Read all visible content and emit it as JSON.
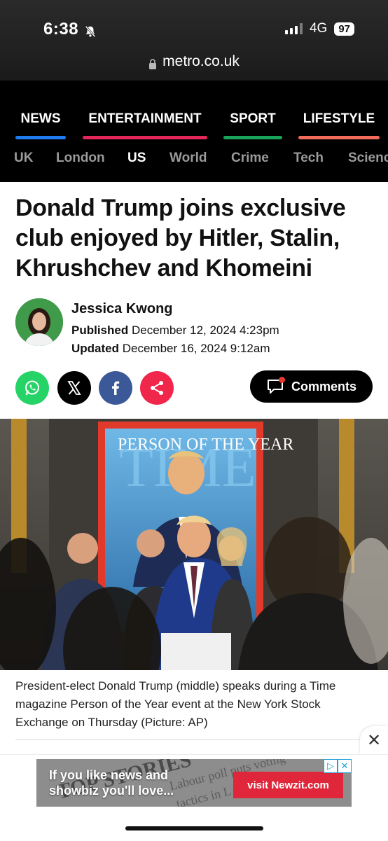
{
  "status": {
    "time": "6:38",
    "network": "4G",
    "battery": "97"
  },
  "browser": {
    "url": "metro.co.uk"
  },
  "nav": {
    "primary": [
      {
        "label": "NEWS",
        "color": "#1e7bf0"
      },
      {
        "label": "ENTERTAINMENT",
        "color": "#e3275a"
      },
      {
        "label": "SPORT",
        "color": "#1aa35a"
      },
      {
        "label": "LIFESTYLE",
        "color": "#f26b5b"
      }
    ],
    "secondary": [
      "UK",
      "London",
      "US",
      "World",
      "Crime",
      "Tech",
      "Scienc"
    ],
    "active_secondary": "US"
  },
  "article": {
    "headline": "Donald Trump joins exclusive club enjoyed by Hitler, Stalin, Khrushchev and Khomeini",
    "author": "Jessica Kwong",
    "published_label": "Published",
    "published": "December 12, 2024 4:23pm",
    "updated_label": "Updated",
    "updated": "December 16, 2024 9:12am",
    "comments_label": "Comments",
    "image_text": "PERSON OF THE YEAR",
    "caption": "President-elect Donald Trump (middle) speaks during a Time magazine Person of the Year event at the New York Stock Exchange on Thursday (Picture: AP)"
  },
  "share": [
    {
      "name": "whatsapp",
      "color": "#25d366"
    },
    {
      "name": "x",
      "color": "#000000"
    },
    {
      "name": "facebook",
      "color": "#3b5998"
    },
    {
      "name": "share",
      "color": "#f0264b"
    }
  ],
  "ad": {
    "text_line1": "If you like news and",
    "text_line2": "showbiz  you'll love...",
    "button": "visit Newzit.com",
    "close": "✕"
  }
}
